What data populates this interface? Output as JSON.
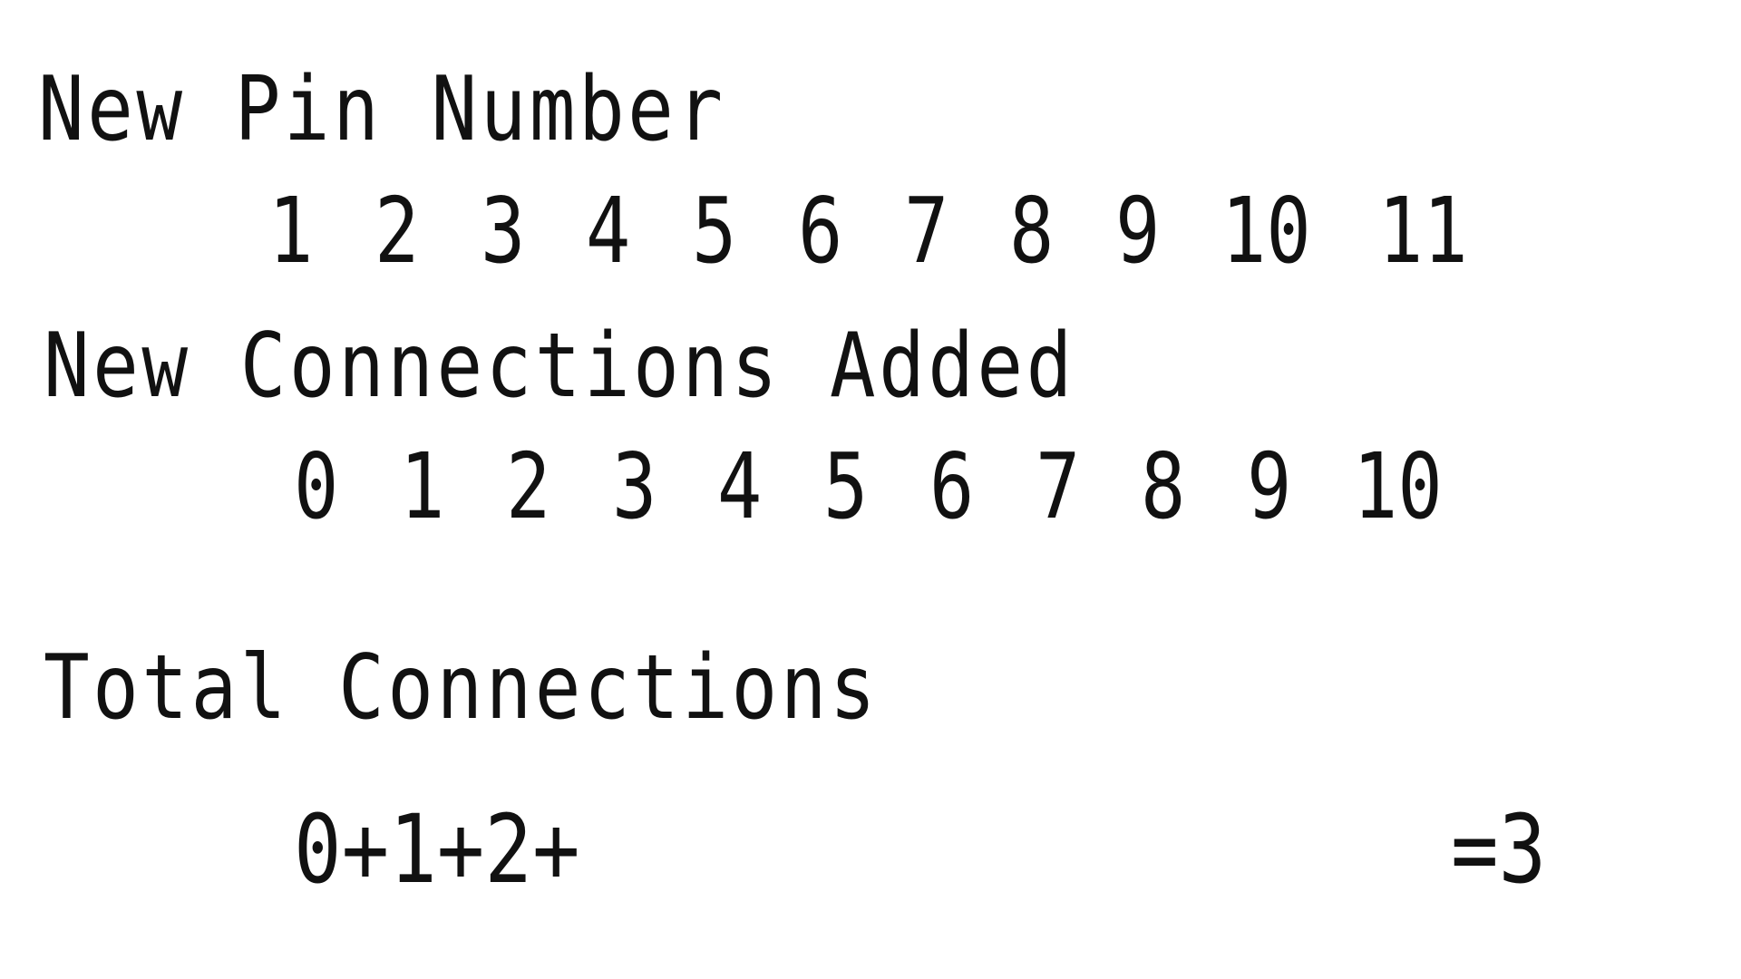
{
  "pin_number": {
    "label": "New Pin Number",
    "values": [
      "1",
      "2",
      "3",
      "4",
      "5",
      "6",
      "7",
      "8",
      "9",
      "10",
      "11"
    ]
  },
  "connections_added": {
    "label": "New Connections Added",
    "values": [
      "0",
      "1",
      "2",
      "3",
      "4",
      "5",
      "6",
      "7",
      "8",
      "9",
      "10"
    ]
  },
  "total": {
    "label": "Total Connections",
    "expression": "0+1+2+",
    "result": "=3"
  }
}
